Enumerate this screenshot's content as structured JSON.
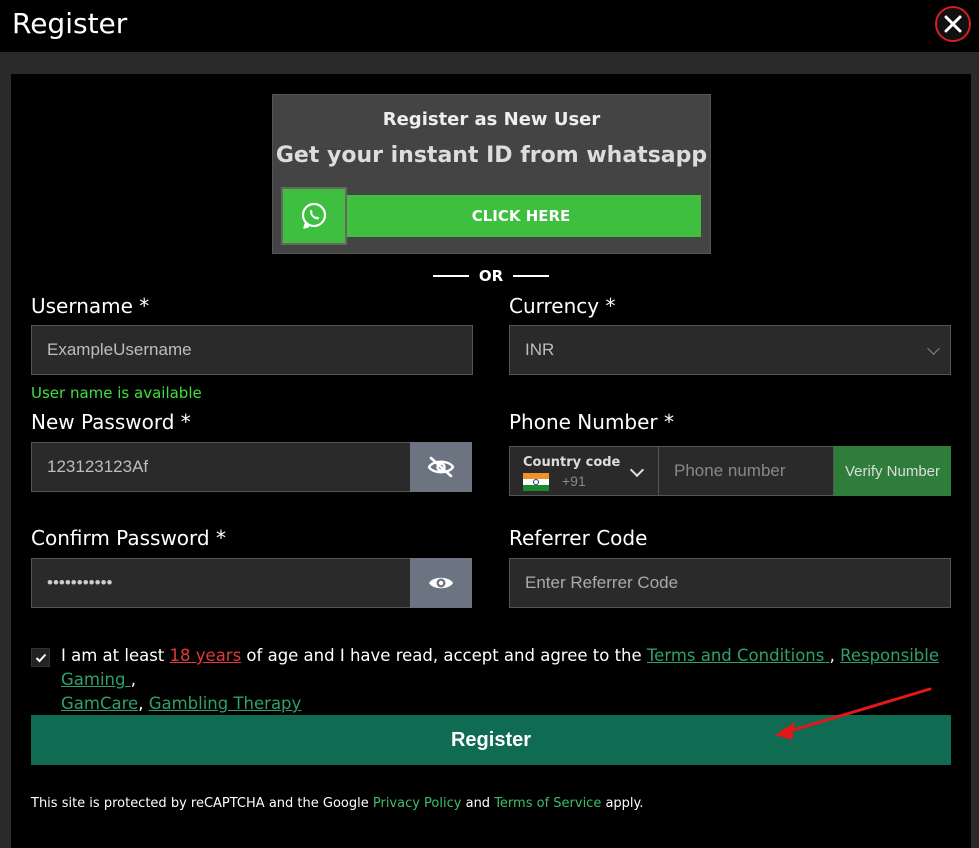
{
  "header": {
    "title": "Register"
  },
  "whatsapp": {
    "title": "Register as New User",
    "subtitle": "Get your instant ID from whatsapp",
    "button_label": "CLICK HERE"
  },
  "separator": "OR",
  "form": {
    "username": {
      "label": "Username *",
      "value": "ExampleUsername",
      "status": "User name is available"
    },
    "currency": {
      "label": "Currency *",
      "value": "INR"
    },
    "new_password": {
      "label": "New Password *",
      "value": "123123123Af"
    },
    "phone": {
      "label": "Phone Number *",
      "country_label": "Country code",
      "country_code": "+91",
      "placeholder": "Phone number",
      "verify_label": "Verify Number"
    },
    "confirm_password": {
      "label": "Confirm Password *",
      "value": "•••••••••••"
    },
    "referrer": {
      "label": "Referrer Code",
      "placeholder": "Enter Referrer Code"
    }
  },
  "agreement": {
    "prefix": "I am at least ",
    "age_link": "18 years",
    "middle": " of age and I have read, accept and agree to the ",
    "terms": "Terms and Conditions ",
    "sep1": ", ",
    "responsible": "Responsible Gaming ",
    "sep2": ",",
    "gamcare": "GamCare",
    "sep3": ", ",
    "therapy": "Gambling Therapy",
    "checked": true
  },
  "register_button": "Register",
  "recaptcha": {
    "prefix": "This site is protected by reCAPTCHA and the Google ",
    "privacy": "Privacy Policy",
    "and": " and ",
    "terms": "Terms of Service",
    "suffix": " apply."
  },
  "colors": {
    "accent_green": "#3fbf3f",
    "register_green": "#0f6b52",
    "close_red": "#d61f1f",
    "link_green": "#2fa06a",
    "link_red": "#e03a3a"
  }
}
